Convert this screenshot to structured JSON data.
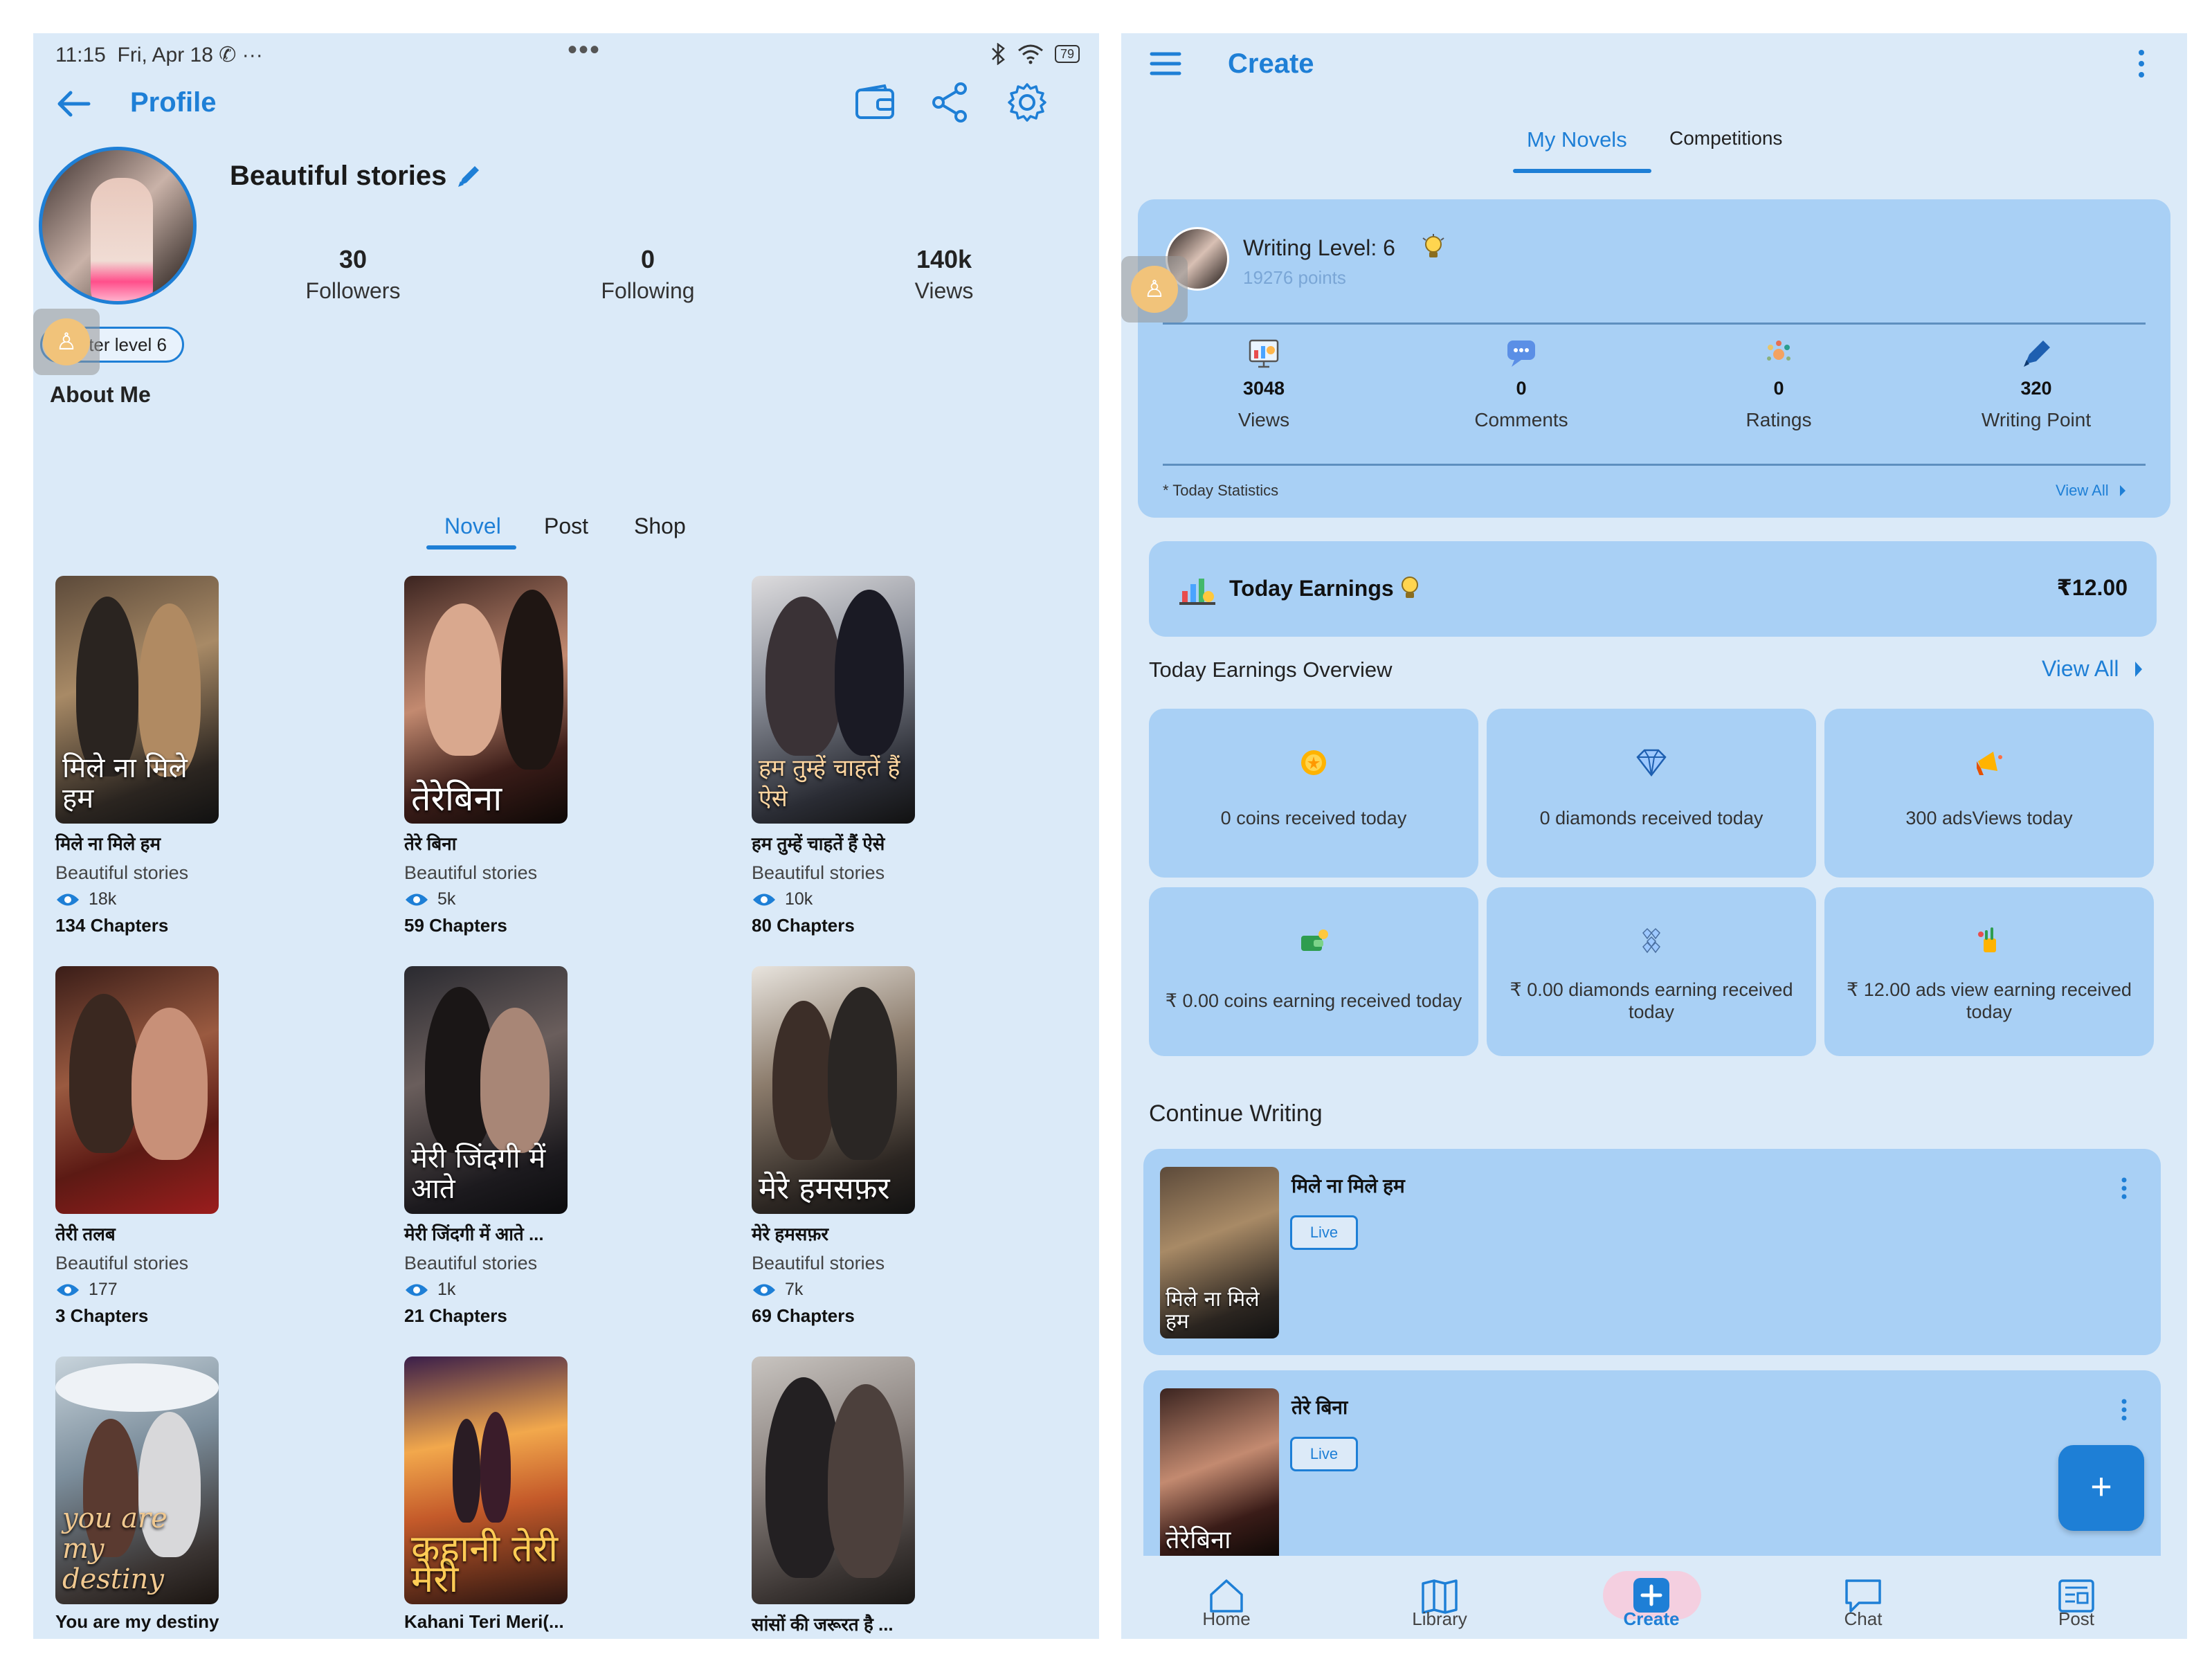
{
  "status_bar": {
    "time": "11:15",
    "date": "Fri, Apr 18",
    "battery": "79"
  },
  "profile": {
    "title": "Profile",
    "name": "Beautiful stories",
    "stats": [
      {
        "value": "30",
        "label": "Followers"
      },
      {
        "value": "0",
        "label": "Following"
      },
      {
        "value": "140k",
        "label": "Views"
      }
    ],
    "badge": "writer level 6",
    "about_label": "About Me",
    "tabs": [
      "Novel",
      "Post",
      "Shop"
    ],
    "active_tab": "Novel",
    "novels": [
      {
        "title": "मिले ना मिले हम",
        "cover_text": "मिले ना मिले हम",
        "author": "Beautiful stories",
        "views": "18k",
        "chapters": "134 Chapters"
      },
      {
        "title": "तेरे बिना",
        "cover_text": "तेरेबिना",
        "author": "Beautiful stories",
        "views": "5k",
        "chapters": "59 Chapters"
      },
      {
        "title": "हम तुम्हें चाहतें हैं ऐसे",
        "cover_text": "हम तुम्हें चाहतें हैं ऐसे",
        "author": "Beautiful stories",
        "views": "10k",
        "chapters": "80 Chapters"
      },
      {
        "title": "तेरी तलब",
        "cover_text": "",
        "author": "Beautiful stories",
        "views": "177",
        "chapters": "3 Chapters"
      },
      {
        "title": "मेरी जिंदगी में आते ...",
        "cover_text": "मेरी जिंदगी में आते",
        "author": "Beautiful stories",
        "views": "1k",
        "chapters": "21 Chapters"
      },
      {
        "title": "मेरे हमसफ़र",
        "cover_text": "मेरे हमसफ़र",
        "author": "Beautiful stories",
        "views": "7k",
        "chapters": "69 Chapters"
      },
      {
        "title": "You are my destiny",
        "cover_text": "you are my destiny",
        "author": "",
        "views": "",
        "chapters": ""
      },
      {
        "title": "Kahani Teri Meri(...",
        "cover_text": "कहानी तेरी मेरी",
        "author": "",
        "views": "",
        "chapters": ""
      },
      {
        "title": "सांसों की जरूरत है ...",
        "cover_text": "",
        "author": "",
        "views": "",
        "chapters": ""
      }
    ]
  },
  "create": {
    "title": "Create",
    "tabs": [
      "My Novels",
      "Competitions"
    ],
    "active_tab": "My Novels",
    "writing_level": "Writing Level: 6",
    "points": "19276 points",
    "stats": [
      {
        "value": "3048",
        "label": "Views"
      },
      {
        "value": "0",
        "label": "Comments"
      },
      {
        "value": "0",
        "label": "Ratings"
      },
      {
        "value": "320",
        "label": "Writing Point"
      }
    ],
    "stats_note": "* Today Statistics",
    "view_all": "View All",
    "today_earnings_label": "Today Earnings",
    "today_earnings_value": "₹12.00",
    "overview_title": "Today Earnings Overview",
    "overview_view_all": "View All",
    "tiles": [
      {
        "text": "0 coins received today",
        "icon": "coin-icon"
      },
      {
        "text": "0 diamonds received today",
        "icon": "diamond-icon"
      },
      {
        "text": "300 adsViews today",
        "icon": "megaphone-icon"
      },
      {
        "text": "₹ 0.00 coins earning received today",
        "icon": "wallet-icon"
      },
      {
        "text": "₹ 0.00 diamonds earning received today",
        "icon": "gem-cluster-icon"
      },
      {
        "text": "₹ 12.00 ads view earning received today",
        "icon": "ads-earning-icon"
      }
    ],
    "continue_title": "Continue Writing",
    "continue_items": [
      {
        "title": "मिले ना मिले हम",
        "status": "Live",
        "cover_text": "मिले ना मिले हम"
      },
      {
        "title": "तेरे बिना",
        "status": "Live",
        "cover_text": "तेरेबिना"
      }
    ],
    "fab_label": "+",
    "bottom_nav": [
      "Home",
      "Library",
      "Create",
      "Chat",
      "Post"
    ],
    "active_nav": "Create"
  },
  "colors": {
    "accent": "#1e7fd6",
    "panel_bg": "#dbeaf8",
    "card_bg": "#a9d0f5"
  }
}
